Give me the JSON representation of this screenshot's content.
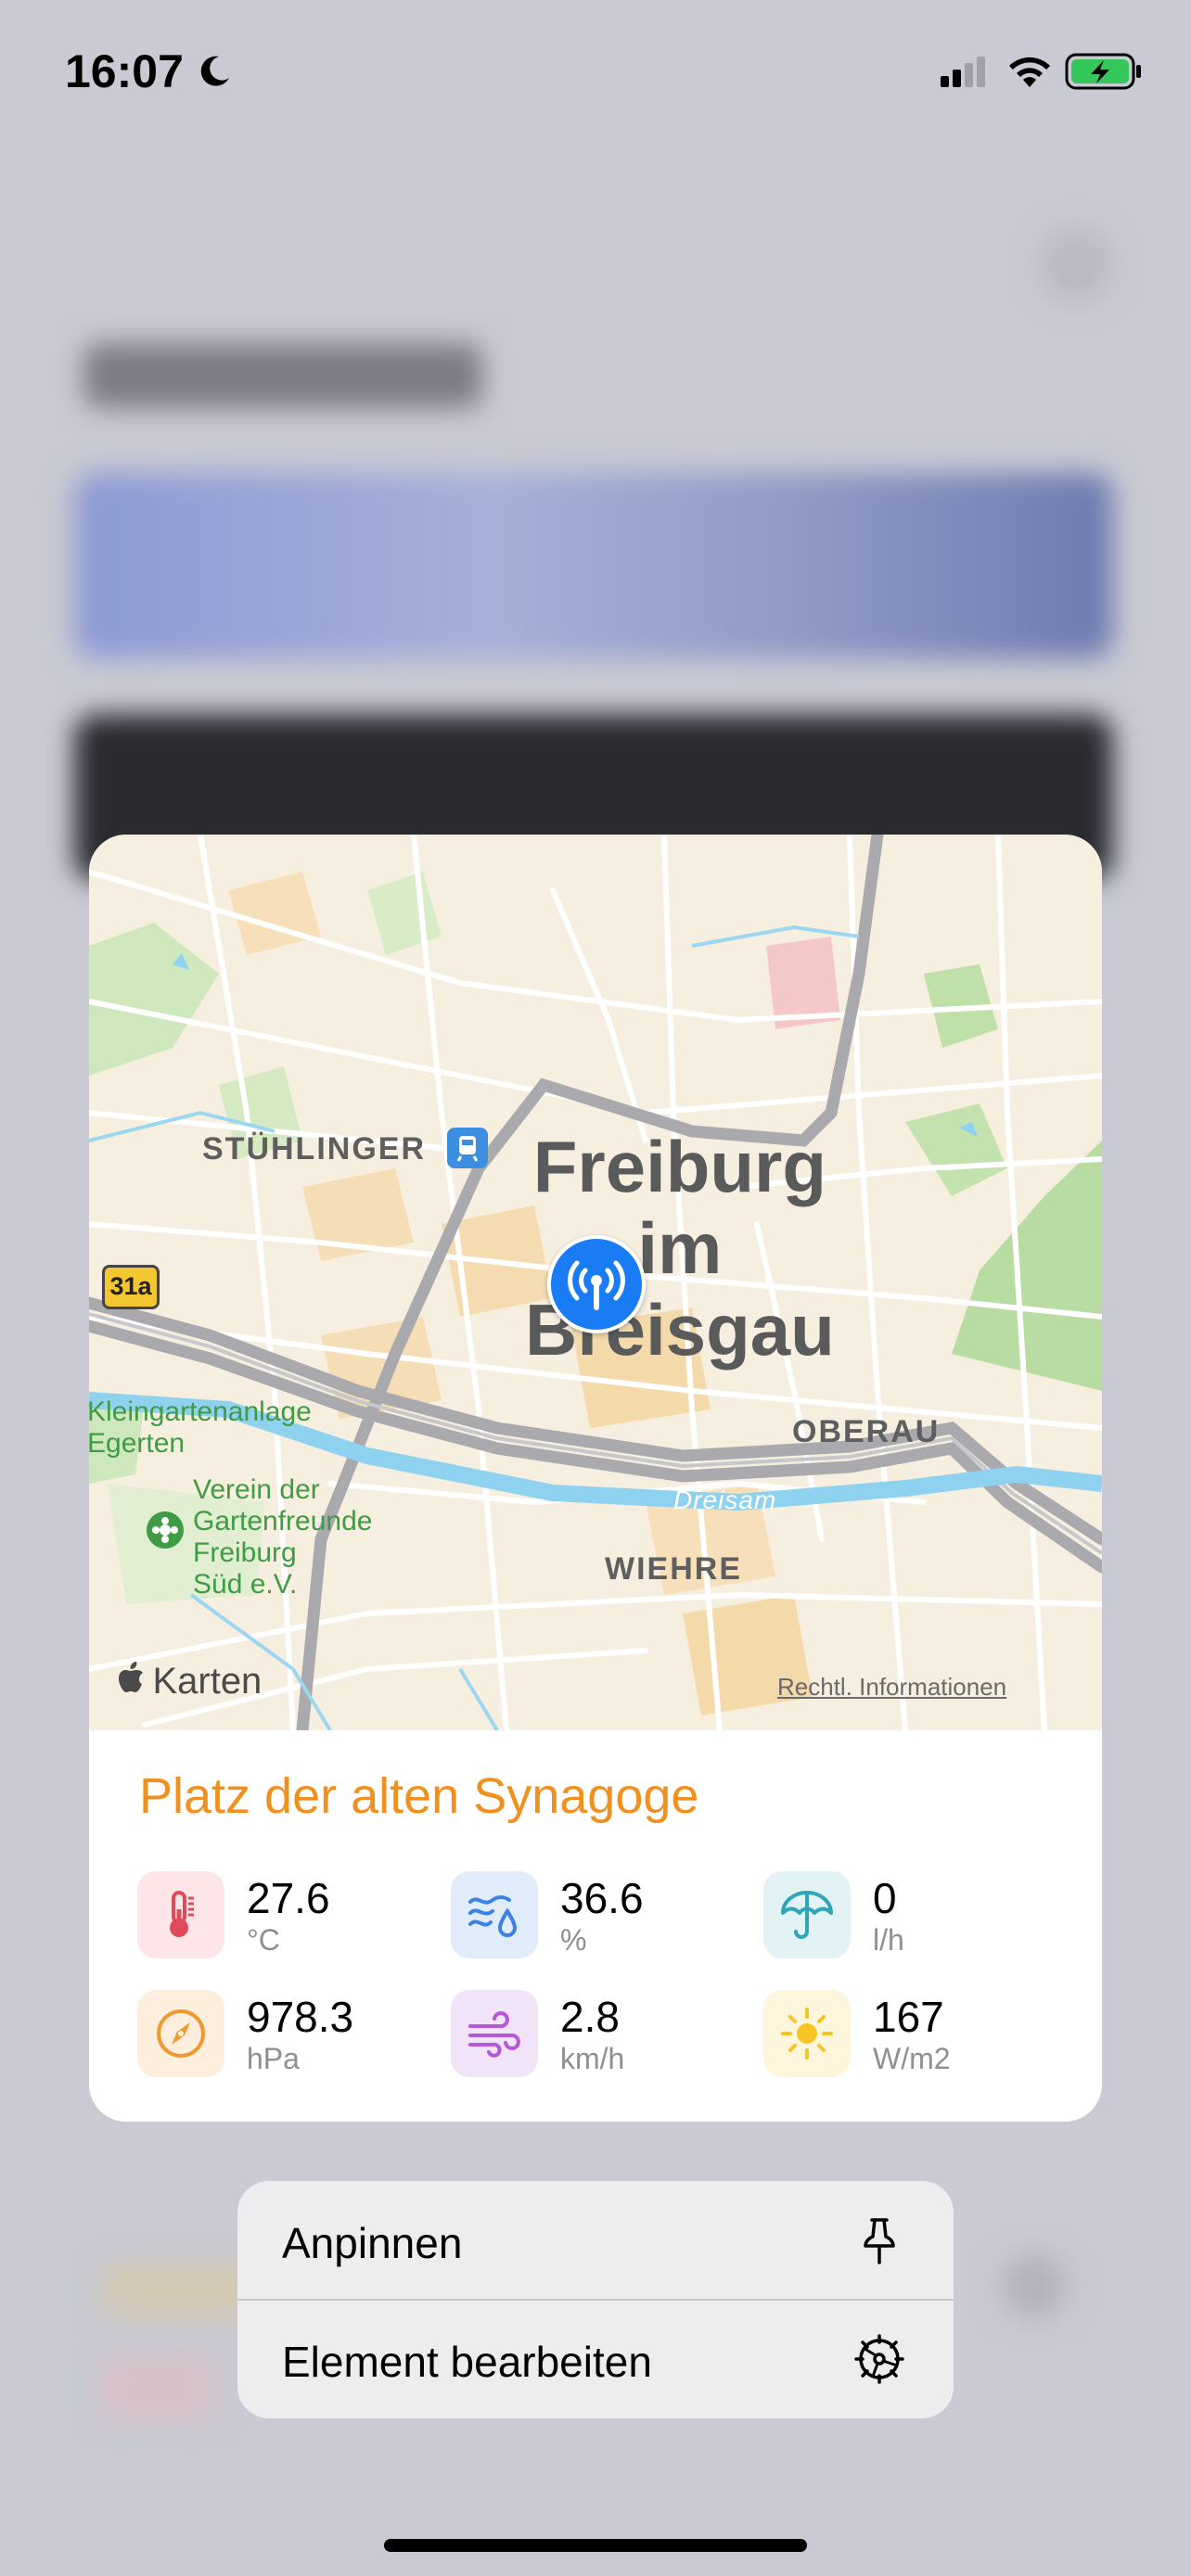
{
  "status_bar": {
    "time": "16:07",
    "icons": [
      "moon-icon",
      "cellular-signal-icon",
      "wifi-icon",
      "battery-charging-icon"
    ]
  },
  "map": {
    "city_name_line1": "Freiburg",
    "city_name_line2": "im",
    "city_name_line3": "Breisgau",
    "districts": [
      "STÜHLINGER",
      "OBERAU",
      "WIEHRE"
    ],
    "green_labels": {
      "allotment_line1": "Kleingartenanlage",
      "allotment_line2": "Egerten",
      "club_line1": "Verein der",
      "club_line2": "Gartenfreunde",
      "club_line3": "Freiburg",
      "club_line4": "Süd e.V."
    },
    "river": "Dreisam",
    "road_shield": "31a",
    "maps_brand": "Karten",
    "legal_link": "Rechtl. Informationen",
    "pin_icon": "antenna-broadcast-icon"
  },
  "station": {
    "name": "Platz der alten Synagoge",
    "metrics": [
      {
        "icon": "thermometer-icon",
        "value": "27.6",
        "unit": "°C"
      },
      {
        "icon": "humidity-icon",
        "value": "36.6",
        "unit": "%"
      },
      {
        "icon": "umbrella-icon",
        "value": "0",
        "unit": "l/h"
      },
      {
        "icon": "gauge-icon",
        "value": "978.3",
        "unit": "hPa"
      },
      {
        "icon": "wind-icon",
        "value": "2.8",
        "unit": "km/h"
      },
      {
        "icon": "sun-icon",
        "value": "167",
        "unit": "W/m2"
      }
    ]
  },
  "context_menu": {
    "items": [
      {
        "label": "Anpinnen",
        "icon": "pin-icon"
      },
      {
        "label": "Element bearbeiten",
        "icon": "gear-icon"
      }
    ]
  },
  "colors": {
    "title_orange": "#f0901e",
    "pin_blue": "#1a7cf5",
    "park_green": "#3f9b44"
  }
}
